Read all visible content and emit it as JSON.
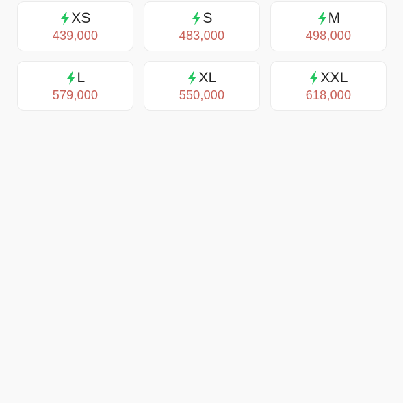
{
  "colors": {
    "bolt": "#22c55e",
    "price": "#c9625a",
    "label": "#222222",
    "background": "#f9f9f9"
  },
  "size_options": [
    {
      "size": "XS",
      "price": "439,000",
      "icon": "lightning-icon"
    },
    {
      "size": "S",
      "price": "483,000",
      "icon": "lightning-icon"
    },
    {
      "size": "M",
      "price": "498,000",
      "icon": "lightning-icon"
    },
    {
      "size": "L",
      "price": "579,000",
      "icon": "lightning-icon"
    },
    {
      "size": "XL",
      "price": "550,000",
      "icon": "lightning-icon"
    },
    {
      "size": "XXL",
      "price": "618,000",
      "icon": "lightning-icon"
    }
  ]
}
